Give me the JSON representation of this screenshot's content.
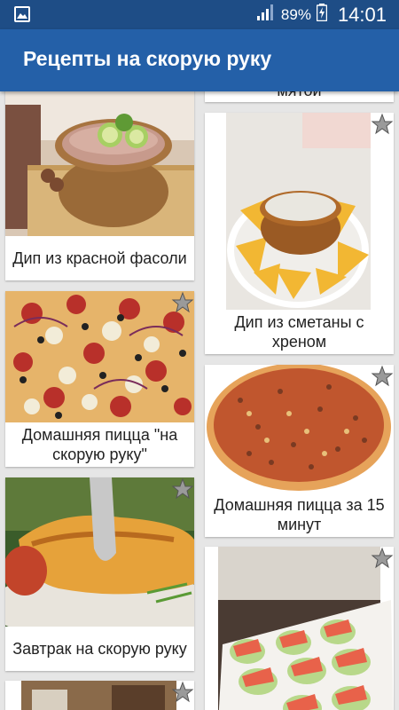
{
  "status_bar": {
    "battery_percent": "89%",
    "time": "14:01"
  },
  "app_bar": {
    "title": "Рецепты на скорую руку"
  },
  "recipes": [
    {
      "title": "Дип из красной фасоли"
    },
    {
      "title": "Домашняя пицца \"на скорую руку\""
    },
    {
      "title": "Завтрак на скорую руку"
    },
    {
      "title": "мятой"
    },
    {
      "title": "Дип из сметаны с хреном"
    },
    {
      "title": "Домашняя пицца за 15 минут"
    }
  ],
  "colors": {
    "status_bar": "#1e4d86",
    "app_bar": "#2460a8",
    "background": "#e6e6e6",
    "star": "#9a9a9a"
  }
}
